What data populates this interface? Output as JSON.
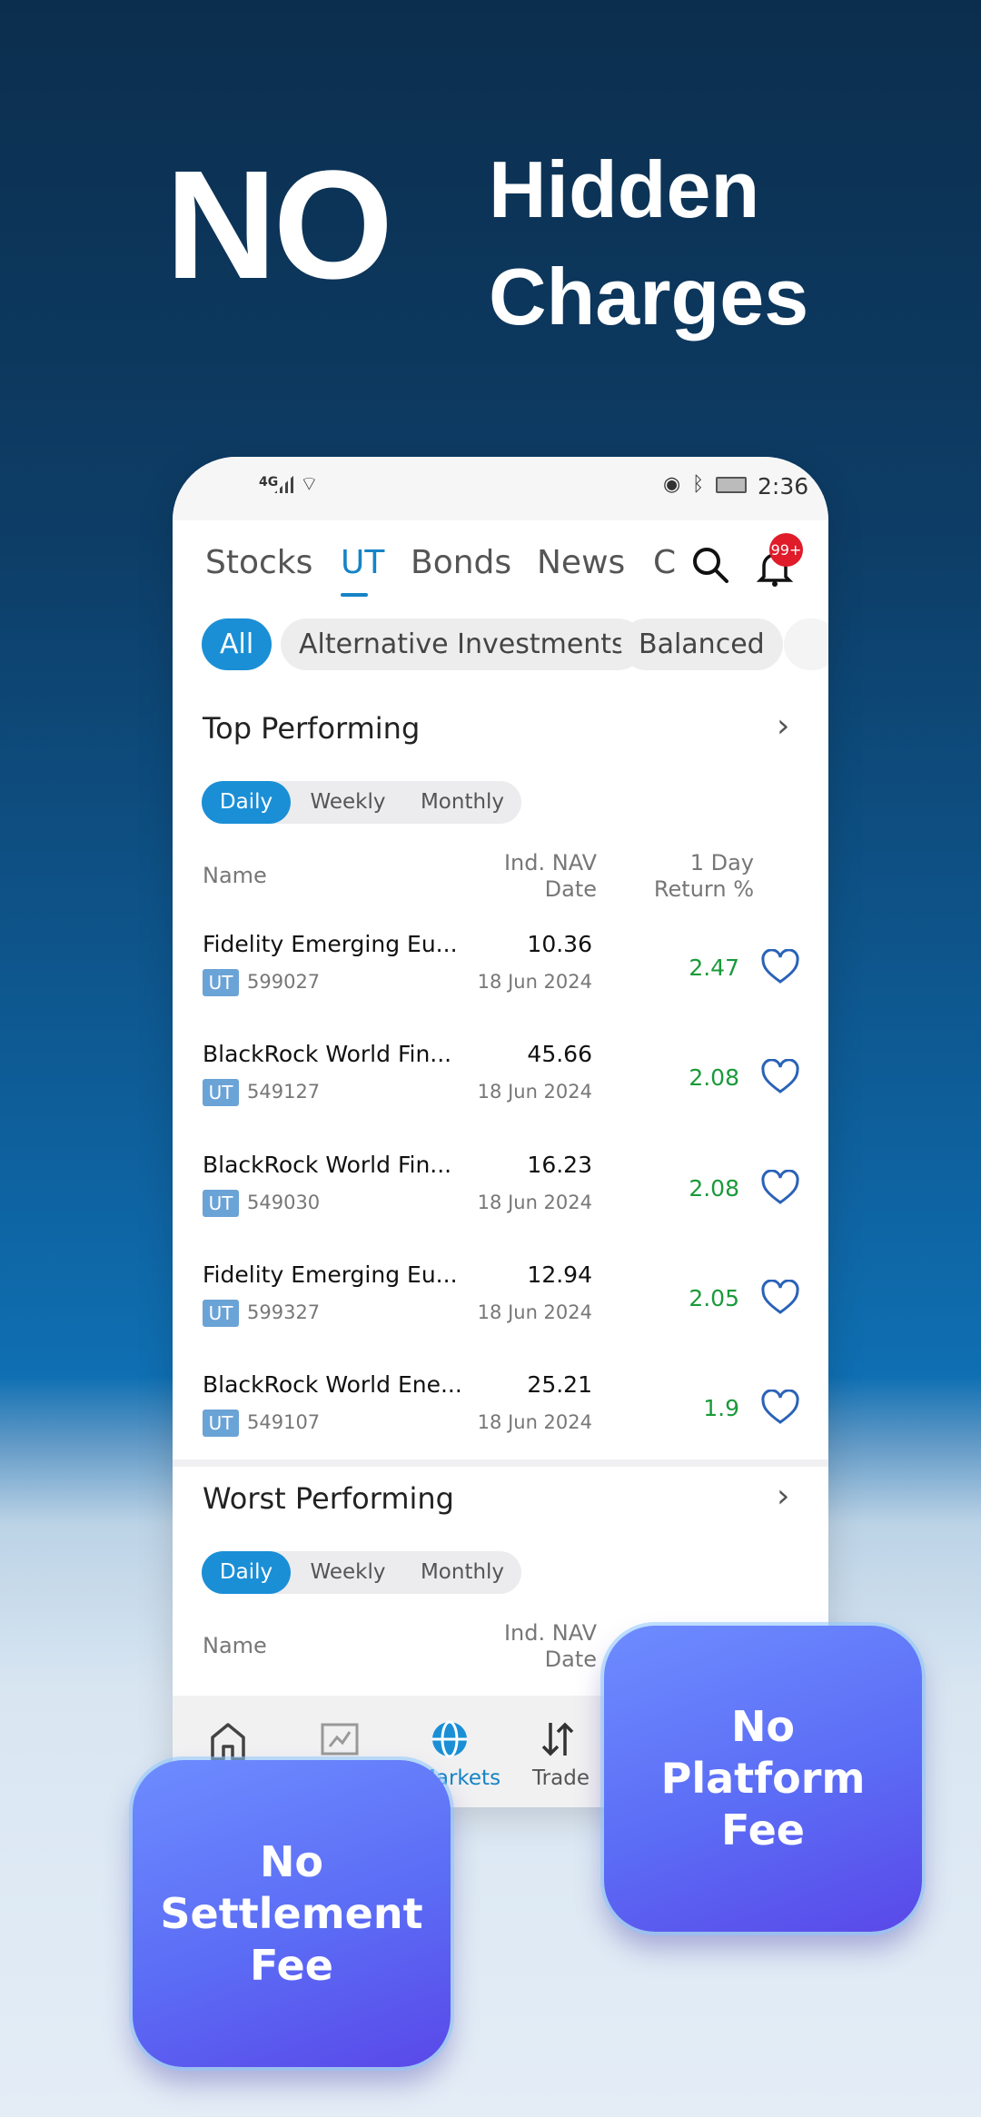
{
  "hero": {
    "big": "NO",
    "line1": "Hidden",
    "line2": "Charges"
  },
  "status": {
    "network": "4G",
    "time": "2:36"
  },
  "tabs": [
    "Stocks",
    "UT",
    "Bonds",
    "News",
    "C"
  ],
  "badge": "99+",
  "chips": [
    "All",
    "Alternative Investments",
    "Balanced"
  ],
  "top": {
    "title": "Top Performing",
    "periods": [
      "Daily",
      "Weekly",
      "Monthly"
    ],
    "headers": {
      "name": "Name",
      "nav1": "Ind. NAV",
      "nav2": "Date",
      "ret1": "1 Day",
      "ret2": "Return %"
    },
    "rows": [
      {
        "name": "Fidelity Emerging Eu...",
        "tag": "UT",
        "code": "599027",
        "nav": "10.36",
        "date": "18 Jun 2024",
        "ret": "2.47"
      },
      {
        "name": "BlackRock World Fin...",
        "tag": "UT",
        "code": "549127",
        "nav": "45.66",
        "date": "18 Jun 2024",
        "ret": "2.08"
      },
      {
        "name": "BlackRock World Fin...",
        "tag": "UT",
        "code": "549030",
        "nav": "16.23",
        "date": "18 Jun 2024",
        "ret": "2.08"
      },
      {
        "name": "Fidelity Emerging Eu...",
        "tag": "UT",
        "code": "599327",
        "nav": "12.94",
        "date": "18 Jun 2024",
        "ret": "2.05"
      },
      {
        "name": "BlackRock World Ene...",
        "tag": "UT",
        "code": "549107",
        "nav": "25.21",
        "date": "18 Jun 2024",
        "ret": "1.9"
      }
    ]
  },
  "worst": {
    "title": "Worst Performing",
    "periods": [
      "Daily",
      "Weekly",
      "Monthly"
    ],
    "headers": {
      "name": "Name",
      "nav1": "Ind. NAV",
      "nav2": "Date"
    }
  },
  "bottom_nav": {
    "markets": "Markets",
    "trade": "Trade"
  },
  "cards": {
    "settlement": [
      "No",
      "Settlement",
      "Fee"
    ],
    "platform": [
      "No",
      "Platform",
      "Fee"
    ]
  },
  "colors": {
    "accent": "#1a8fd6",
    "positive": "#1a9a3a",
    "badge": "#e01b2a"
  }
}
